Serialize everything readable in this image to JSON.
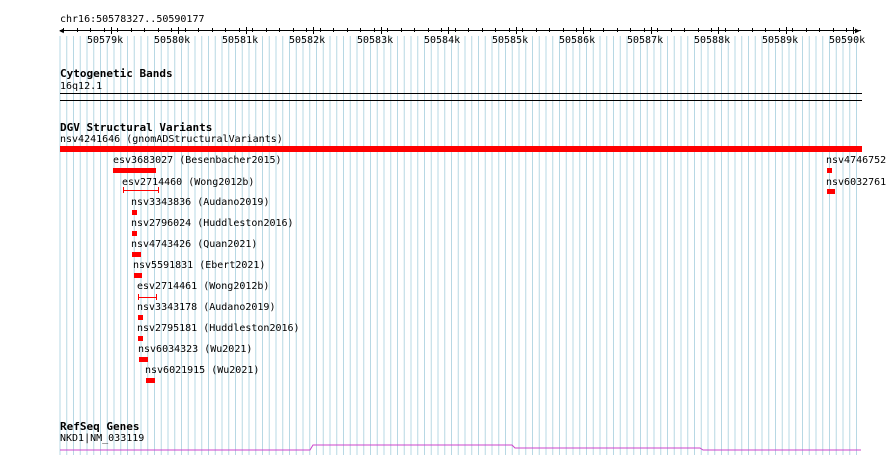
{
  "ruler": {
    "location": "chr16:50578327..50590177",
    "ticks": [
      "50579k",
      "50580k",
      "50581k",
      "50582k",
      "50583k",
      "50584k",
      "50585k",
      "50586k",
      "50587k",
      "50588k",
      "50589k",
      "50590k"
    ]
  },
  "cytobands": {
    "title": "Cytogenetic Bands",
    "band": "16q12.1"
  },
  "dgv": {
    "title": "DGV Structural Variants",
    "items": [
      {
        "label": "nsv4241646 (gnomADStructuralVariants)"
      },
      {
        "label": "esv3683027 (Besenbacher2015)"
      },
      {
        "label": "esv2714460 (Wong2012b)"
      },
      {
        "label": "nsv3343836 (Audano2019)"
      },
      {
        "label": "nsv2796024 (Huddleston2016)"
      },
      {
        "label": "nsv4743426 (Quan2021)"
      },
      {
        "label": "nsv5591831 (Ebert2021)"
      },
      {
        "label": "esv2714461 (Wong2012b)"
      },
      {
        "label": "nsv3343178 (Audano2019)"
      },
      {
        "label": "nsv2795181 (Huddleston2016)"
      },
      {
        "label": "nsv6034323 (Wu2021)"
      },
      {
        "label": "nsv6021915 (Wu2021)"
      },
      {
        "label": "nsv4746752"
      },
      {
        "label": "nsv6032761"
      }
    ]
  },
  "refseq": {
    "title": "RefSeq Genes",
    "gene": "NKD1|NM_033119"
  },
  "colors": {
    "variant": "#ff0000",
    "gene": "#cc44cc",
    "grid": "#b7d8e4"
  }
}
